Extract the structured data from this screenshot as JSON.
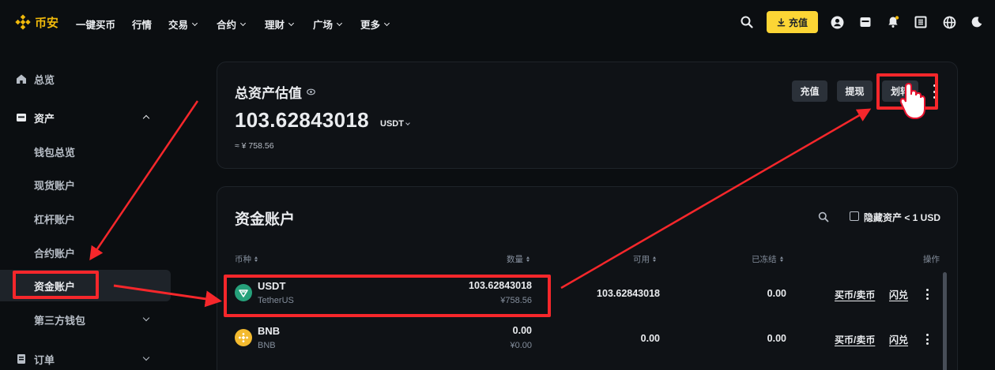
{
  "nav": {
    "logo_text": "币安",
    "items": [
      {
        "label": "一键买币",
        "has_dropdown": false
      },
      {
        "label": "行情",
        "has_dropdown": false
      },
      {
        "label": "交易",
        "has_dropdown": true
      },
      {
        "label": "合约",
        "has_dropdown": true
      },
      {
        "label": "理财",
        "has_dropdown": true
      },
      {
        "label": "广场",
        "has_dropdown": true
      },
      {
        "label": "更多",
        "has_dropdown": true
      }
    ],
    "deposit_label": "充值",
    "icons": [
      "search-icon",
      "user-icon",
      "wallet-icon",
      "bell-icon",
      "download-icon",
      "globe-icon",
      "moon-icon"
    ],
    "accent_color": "#fcd535"
  },
  "sidebar": {
    "items": [
      {
        "label": "总览",
        "icon": "home-icon"
      },
      {
        "label": "资产",
        "icon": "wallet-icon",
        "expanded": true
      },
      {
        "label": "钱包总览"
      },
      {
        "label": "现货账户"
      },
      {
        "label": "杠杆账户"
      },
      {
        "label": "合约账户"
      },
      {
        "label": "资金账户",
        "active": true
      },
      {
        "label": "第三方钱包",
        "has_dropdown": true
      },
      {
        "label": "订单",
        "icon": "orders-icon",
        "has_dropdown": true
      }
    ]
  },
  "asset_summary": {
    "title": "总资产估值",
    "amount": "103.62843018",
    "unit": "USDT",
    "cny": "≈ ¥ 758.56",
    "buttons": {
      "deposit": "充值",
      "withdraw": "提现",
      "transfer": "划转"
    }
  },
  "funding_account": {
    "title": "资金账户",
    "hide_small_label": "隐藏资产 < 1 USD",
    "columns": {
      "coin": "币种",
      "amount": "数量",
      "available": "可用",
      "frozen": "已冻结",
      "action": "操作"
    },
    "rows": [
      {
        "symbol": "USDT",
        "name": "TetherUS",
        "amount": "103.62843018",
        "amount_cny": "¥758.56",
        "available": "103.62843018",
        "frozen": "0.00",
        "buy_sell": "买币/卖币",
        "convert": "闪兑",
        "icon_color": "#26a17b"
      },
      {
        "symbol": "BNB",
        "name": "BNB",
        "amount": "0.00",
        "amount_cny": "¥0.00",
        "available": "0.00",
        "frozen": "0.00",
        "buy_sell": "买币/卖币",
        "convert": "闪兑",
        "icon_color": "#f3ba2f"
      }
    ]
  },
  "annotation_color": "#f6272b"
}
